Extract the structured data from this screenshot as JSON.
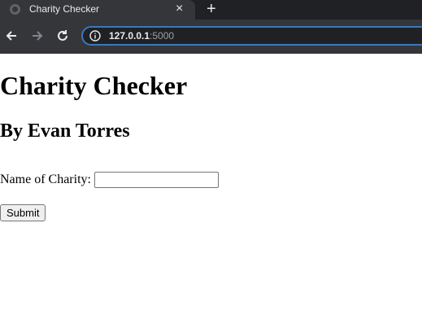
{
  "browser": {
    "tab_title": "Charity Checker",
    "tab_close": "×",
    "new_tab": "+",
    "url_host": "127.0.0.1",
    "url_port": ":5000",
    "icons": [
      "back-arrow-icon",
      "forward-arrow-icon",
      "reload-icon",
      "info-icon",
      "globe-icon"
    ]
  },
  "page": {
    "title": "Charity Checker",
    "subtitle": "By Evan Torres",
    "form": {
      "label": "Name of Charity:",
      "input_value": "",
      "submit_label": "Submit"
    }
  }
}
